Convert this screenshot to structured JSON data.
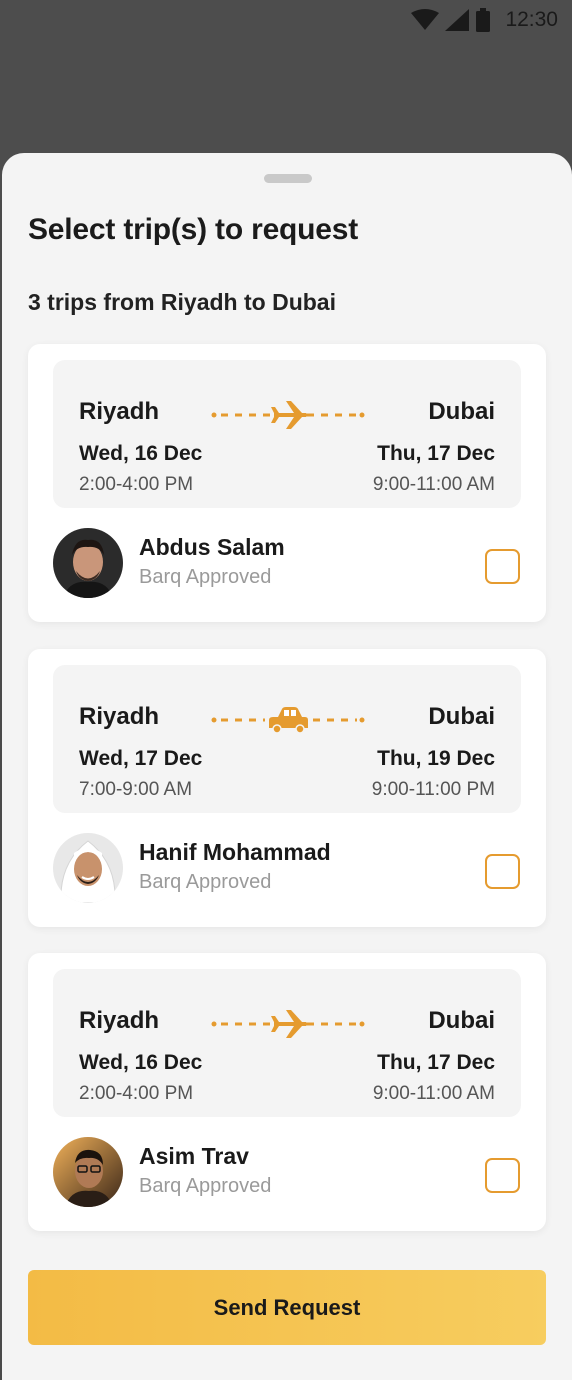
{
  "status_bar": {
    "time": "12:30"
  },
  "sheet": {
    "title": "Select trip(s) to request",
    "subtitle": "3 trips from Riyadh to Dubai"
  },
  "trips": [
    {
      "from_city": "Riyadh",
      "to_city": "Dubai",
      "from_date": "Wed, 16 Dec",
      "to_date": "Thu, 17 Dec",
      "from_time": "2:00-4:00 PM",
      "to_time": "9:00-11:00 AM",
      "vehicle_icon": "plane-icon",
      "driver_name": "Abdus Salam",
      "driver_status": "Barq Approved",
      "selected": false
    },
    {
      "from_city": "Riyadh",
      "to_city": "Dubai",
      "from_date": "Wed, 17 Dec",
      "to_date": "Thu, 19 Dec",
      "from_time": "7:00-9:00 AM",
      "to_time": "9:00-11:00 PM",
      "vehicle_icon": "car-icon",
      "driver_name": "Hanif Mohammad",
      "driver_status": "Barq Approved",
      "selected": false
    },
    {
      "from_city": "Riyadh",
      "to_city": "Dubai",
      "from_date": "Wed, 16 Dec",
      "to_date": "Thu, 17 Dec",
      "from_time": "2:00-4:00 PM",
      "to_time": "9:00-11:00 AM",
      "vehicle_icon": "plane-icon",
      "driver_name": "Asim Trav",
      "driver_status": "Barq Approved",
      "selected": false
    }
  ],
  "actions": {
    "send_label": "Send Request"
  },
  "colors": {
    "accent": "#e59b2f",
    "button": "#f5c453",
    "sheet_bg": "#f4f4f4"
  }
}
